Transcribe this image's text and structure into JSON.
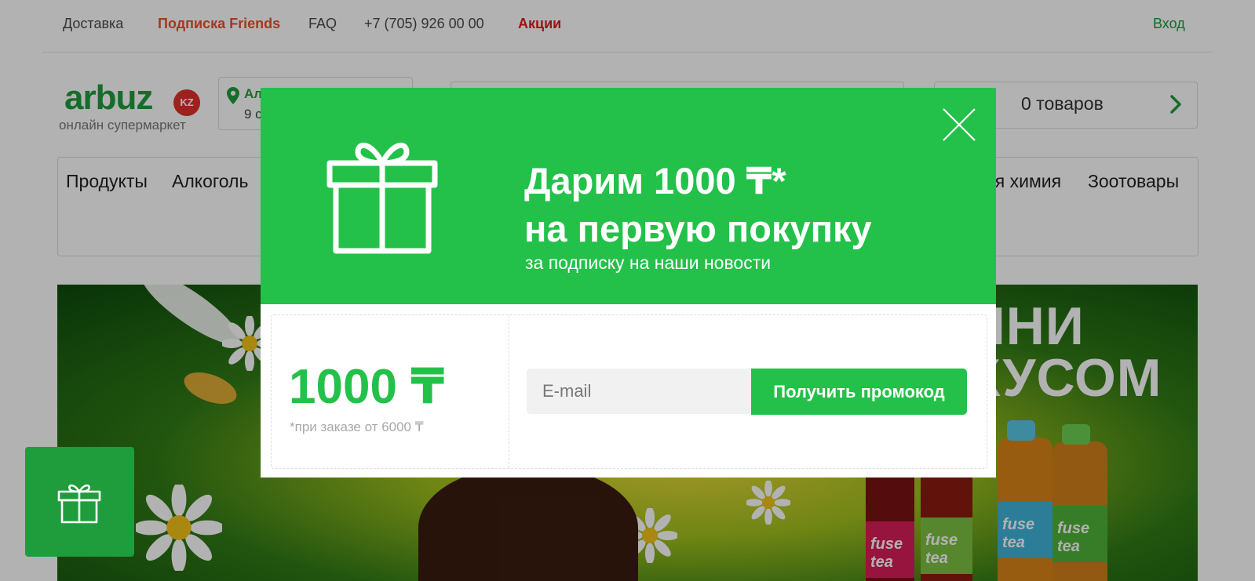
{
  "topnav": {
    "delivery": "Доставка",
    "friends": "Подписка Friends",
    "faq": "FAQ",
    "phone": "+7 (705) 926 00 00",
    "promotions": "Акции",
    "login": "Вход"
  },
  "header": {
    "logo": "arbuz",
    "logo_badge": "KZ",
    "logo_tagline": "онлайн супермаркет",
    "location_city": "Ал",
    "location_time": "9 с",
    "cart_count": "0 товаров"
  },
  "categories": [
    "Продукты",
    "Алкоголь",
    "ая химия",
    "Зоотовары"
  ],
  "banner": {
    "headline_line1": "ЛНИ",
    "headline_line2": "КУСОМ",
    "bottle_brand": "fuse tea"
  },
  "modal": {
    "title_line1": "Дарим 1000 ₸*",
    "title_line2": "на первую покупку",
    "subtitle": "за подписку на наши новости",
    "amount": "1000 ₸",
    "amount_note": "*при заказе от 6000 ₸",
    "email_placeholder": "E-mail",
    "submit_label": "Получить промокод"
  },
  "colors": {
    "brand_green": "#1f9d3c",
    "modal_green": "#23c14a",
    "friends_orange": "#e6532d",
    "promo_red": "#e11b1b",
    "badge_red": "#e1312a"
  },
  "icons": [
    "map-pin-icon",
    "chevron-right-icon",
    "gift-icon",
    "close-icon"
  ]
}
